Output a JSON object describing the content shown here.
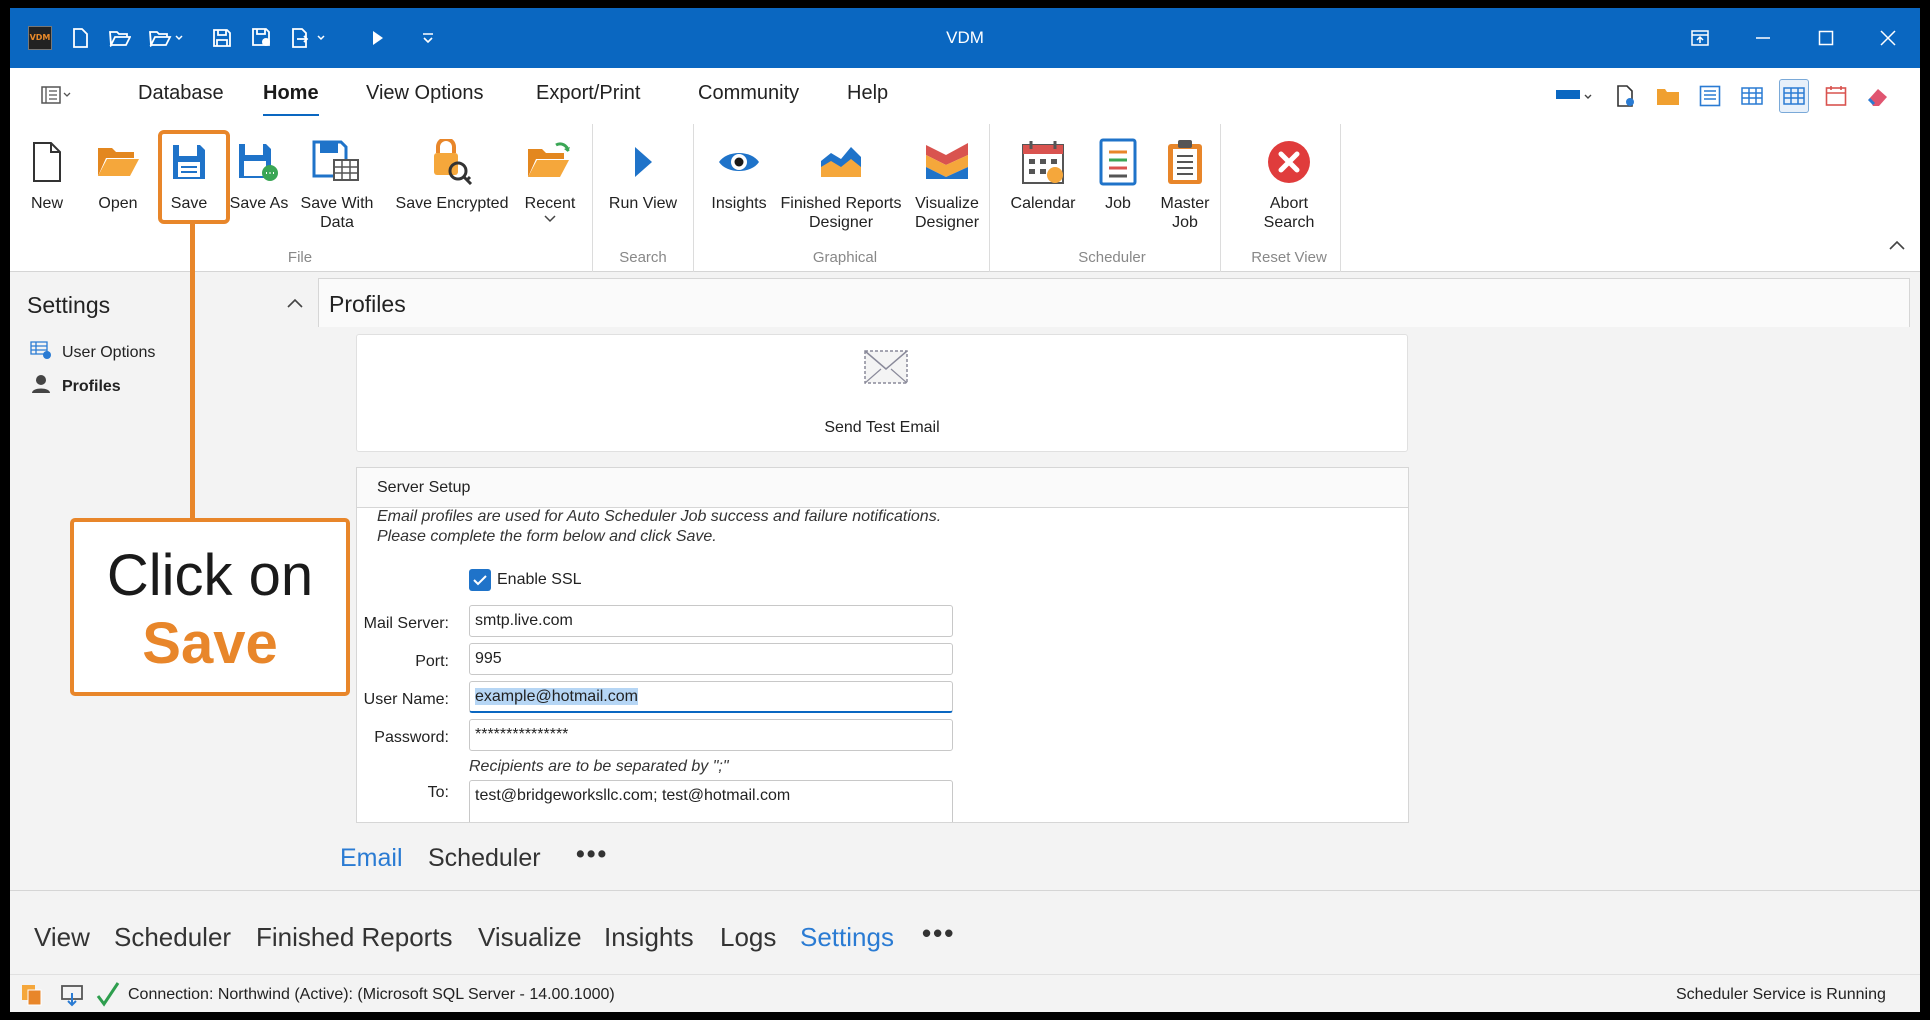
{
  "window": {
    "title": "VDM",
    "app_logo": "VDM",
    "quick_access_icons": [
      "new-file-icon",
      "open-folder-icon",
      "open-recent-icon",
      "save-icon",
      "save-all-icon",
      "export-icon",
      "run-icon",
      "customize-icon"
    ],
    "controls": [
      "pin-icon",
      "minimize-icon",
      "maximize-icon",
      "close-icon"
    ]
  },
  "menu": {
    "tabs": [
      "Database",
      "Home",
      "View Options",
      "Export/Print",
      "Community",
      "Help"
    ],
    "active_tab": "Home"
  },
  "ribbon": {
    "buttons": {
      "new": "New",
      "open": "Open",
      "save": "Save",
      "save_as": "Save As",
      "save_with_data_1": "Save With",
      "save_with_data_2": "Data",
      "save_encrypted": "Save Encrypted",
      "recent": "Recent",
      "run_view": "Run View",
      "insights": "Insights",
      "finished_reports_1": "Finished Reports",
      "finished_reports_2": "Designer",
      "visualize_1": "Visualize",
      "visualize_2": "Designer",
      "calendar": "Calendar",
      "job": "Job",
      "master_job_1": "Master",
      "master_job_2": "Job",
      "abort_1": "Abort",
      "abort_2": "Search"
    },
    "groups": {
      "file": "File",
      "search": "Search",
      "graphical": "Graphical",
      "scheduler": "Scheduler",
      "reset_view": "Reset View"
    }
  },
  "settings_panel": {
    "title": "Settings",
    "items": [
      "User Options",
      "Profiles"
    ]
  },
  "profiles": {
    "header": "Profiles",
    "send_test_email": "Send Test Email",
    "server_setup": {
      "title": "Server Setup",
      "note_1": "Email profiles are used for Auto Scheduler Job success and failure notifications.",
      "note_2": "Please complete the form below and click Save.",
      "enable_ssl_label": "Enable SSL",
      "enable_ssl": true,
      "mail_server_label": "Mail Server:",
      "mail_server": "smtp.live.com",
      "port_label": "Port:",
      "port": "995",
      "user_name_label": "User Name:",
      "user_name": "example@hotmail.com",
      "password_label": "Password:",
      "password": "***************",
      "recipients_note": "Recipients are to be separated by \";\"",
      "to_label": "To:",
      "to": "test@bridgeworksllc.com; test@hotmail.com"
    },
    "sub_tabs": [
      "Email",
      "Scheduler"
    ],
    "active_sub_tab": "Email",
    "more": "•••"
  },
  "bottom_nav": {
    "tabs": [
      "View",
      "Scheduler",
      "Finished Reports",
      "Visualize",
      "Insights",
      "Logs",
      "Settings"
    ],
    "active": "Settings",
    "more": "•••"
  },
  "status": {
    "connection": "Connection: Northwind (Active): (Microsoft SQL Server - 14.00.1000)",
    "scheduler": "Scheduler Service is Running"
  },
  "annotation": {
    "line1": "Click on",
    "line2": "Save"
  },
  "colors": {
    "title_bar": "#0a67c1",
    "accent": "#2a7bd3",
    "annotation": "#e8862a"
  }
}
